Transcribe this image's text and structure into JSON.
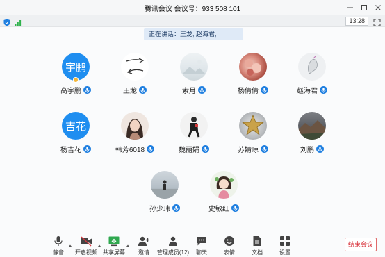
{
  "window": {
    "title": "腾讯会议  会议号：933 508 101"
  },
  "statusbar": {
    "time": "13:28"
  },
  "speaking": {
    "text": "正在讲话：王龙; 赵海君;"
  },
  "participants": [
    {
      "name": "高宇鹏",
      "avatar_text": "宇鹏",
      "avatar_type": "text"
    },
    {
      "name": "王龙",
      "avatar_type": "image",
      "avatar_icon": "arrows-sketch"
    },
    {
      "name": "索月",
      "avatar_type": "image",
      "avatar_icon": "landscape-picture"
    },
    {
      "name": "杨倩倩",
      "avatar_type": "image",
      "avatar_icon": "flowers-photo"
    },
    {
      "name": "赵海君",
      "avatar_type": "image",
      "avatar_icon": "decorative-sketch"
    },
    {
      "name": "杨吉花",
      "avatar_text": "吉花",
      "avatar_type": "text"
    },
    {
      "name": "韩芳6018",
      "avatar_type": "image",
      "avatar_icon": "portrait-photo"
    },
    {
      "name": "魏丽娟",
      "avatar_type": "image",
      "avatar_icon": "person-photo"
    },
    {
      "name": "苏婧琼",
      "avatar_type": "image",
      "avatar_icon": "star-photo"
    },
    {
      "name": "刘鹏",
      "avatar_type": "image",
      "avatar_icon": "mountain-photo"
    },
    {
      "name": "孙少玮",
      "avatar_type": "image",
      "avatar_icon": "beach-photo"
    },
    {
      "name": "史敏红",
      "avatar_type": "image",
      "avatar_icon": "cartoon-girl"
    }
  ],
  "toolbar": {
    "mute": "静音",
    "video": "开启视频",
    "share": "共享屏幕",
    "invite": "邀请",
    "members": "管理成员(12)",
    "chat": "聊天",
    "reactions": "表情",
    "docs": "文档",
    "settings": "设置",
    "end": "结束会议"
  },
  "colors": {
    "accent": "#1f8ef0",
    "end": "#d9363e",
    "banner": "#dfeaf7"
  }
}
